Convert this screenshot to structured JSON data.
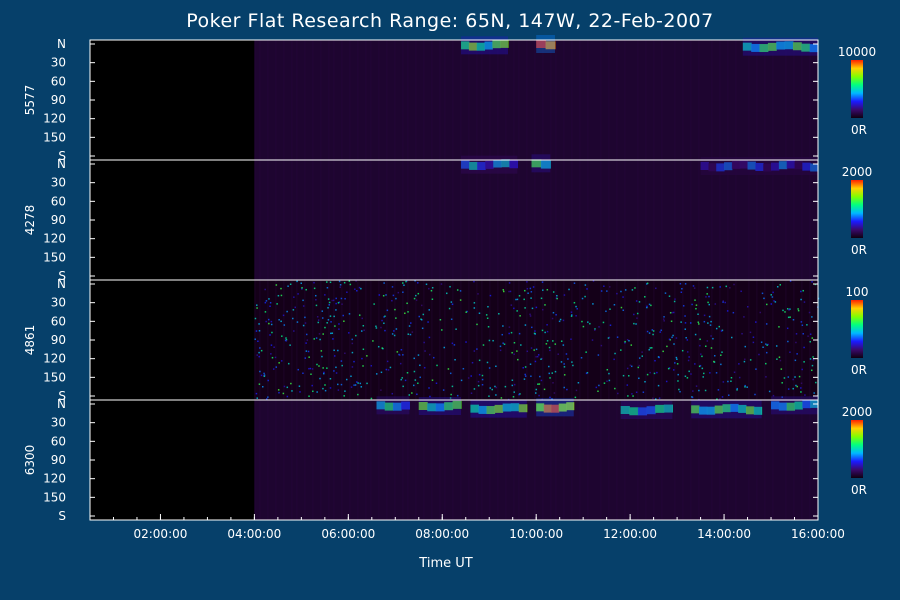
{
  "title": "Poker Flat Research Range: 65N, 147W, 22-Feb-2007",
  "colors": {
    "background": "#06406a",
    "plot_black": "#000000",
    "axis": "#ffffff",
    "colormap": [
      "#0f0010",
      "#3a0a6a",
      "#1a1aff",
      "#00b8ff",
      "#00ff80",
      "#80ff00",
      "#ffd000",
      "#ff2000"
    ]
  },
  "chart_data": {
    "type": "heatmap",
    "xlabel": "Time UT",
    "x_ticks": [
      "02:00:00",
      "04:00:00",
      "06:00:00",
      "08:00:00",
      "10:00:00",
      "12:00:00",
      "14:00:00",
      "16:00:00"
    ],
    "x_tick_hours": [
      2,
      4,
      6,
      8,
      10,
      12,
      14,
      16
    ],
    "xlim_hours": [
      0.5,
      16
    ],
    "data_start_hour": 4.0,
    "y_ticks": [
      "N",
      "30",
      "60",
      "90",
      "120",
      "150",
      "S"
    ],
    "panels": [
      {
        "ylabel": "5577",
        "cbar_max": "10000",
        "cbar_min": "0R",
        "bands": [
          {
            "start": 8.4,
            "end": 9.4,
            "angle": 5,
            "intensity": 0.6
          },
          {
            "start": 10.0,
            "end": 10.4,
            "angle": 3,
            "intensity": 0.95
          },
          {
            "start": 14.4,
            "end": 16.0,
            "angle": 7,
            "intensity": 0.55
          }
        ]
      },
      {
        "ylabel": "4278",
        "cbar_max": "2000",
        "cbar_min": "0R",
        "bands": [
          {
            "start": 8.4,
            "end": 9.6,
            "angle": 4,
            "intensity": 0.35
          },
          {
            "start": 9.9,
            "end": 10.3,
            "angle": 2,
            "intensity": 0.5
          },
          {
            "start": 13.5,
            "end": 16.0,
            "angle": 6,
            "intensity": 0.25
          }
        ]
      },
      {
        "ylabel": "4861",
        "cbar_max": "100",
        "cbar_min": "0R",
        "bands": []
      },
      {
        "ylabel": "6300",
        "cbar_max": "2000",
        "cbar_min": "0R",
        "bands": [
          {
            "start": 6.6,
            "end": 7.3,
            "angle": 5,
            "intensity": 0.45
          },
          {
            "start": 7.5,
            "end": 8.4,
            "angle": 6,
            "intensity": 0.55
          },
          {
            "start": 8.6,
            "end": 9.8,
            "angle": 10,
            "intensity": 0.6
          },
          {
            "start": 10.0,
            "end": 10.8,
            "angle": 8,
            "intensity": 0.85
          },
          {
            "start": 11.8,
            "end": 12.9,
            "angle": 12,
            "intensity": 0.45
          },
          {
            "start": 13.3,
            "end": 14.8,
            "angle": 11,
            "intensity": 0.55
          },
          {
            "start": 15.0,
            "end": 16.0,
            "angle": 5,
            "intensity": 0.5
          }
        ]
      }
    ]
  }
}
